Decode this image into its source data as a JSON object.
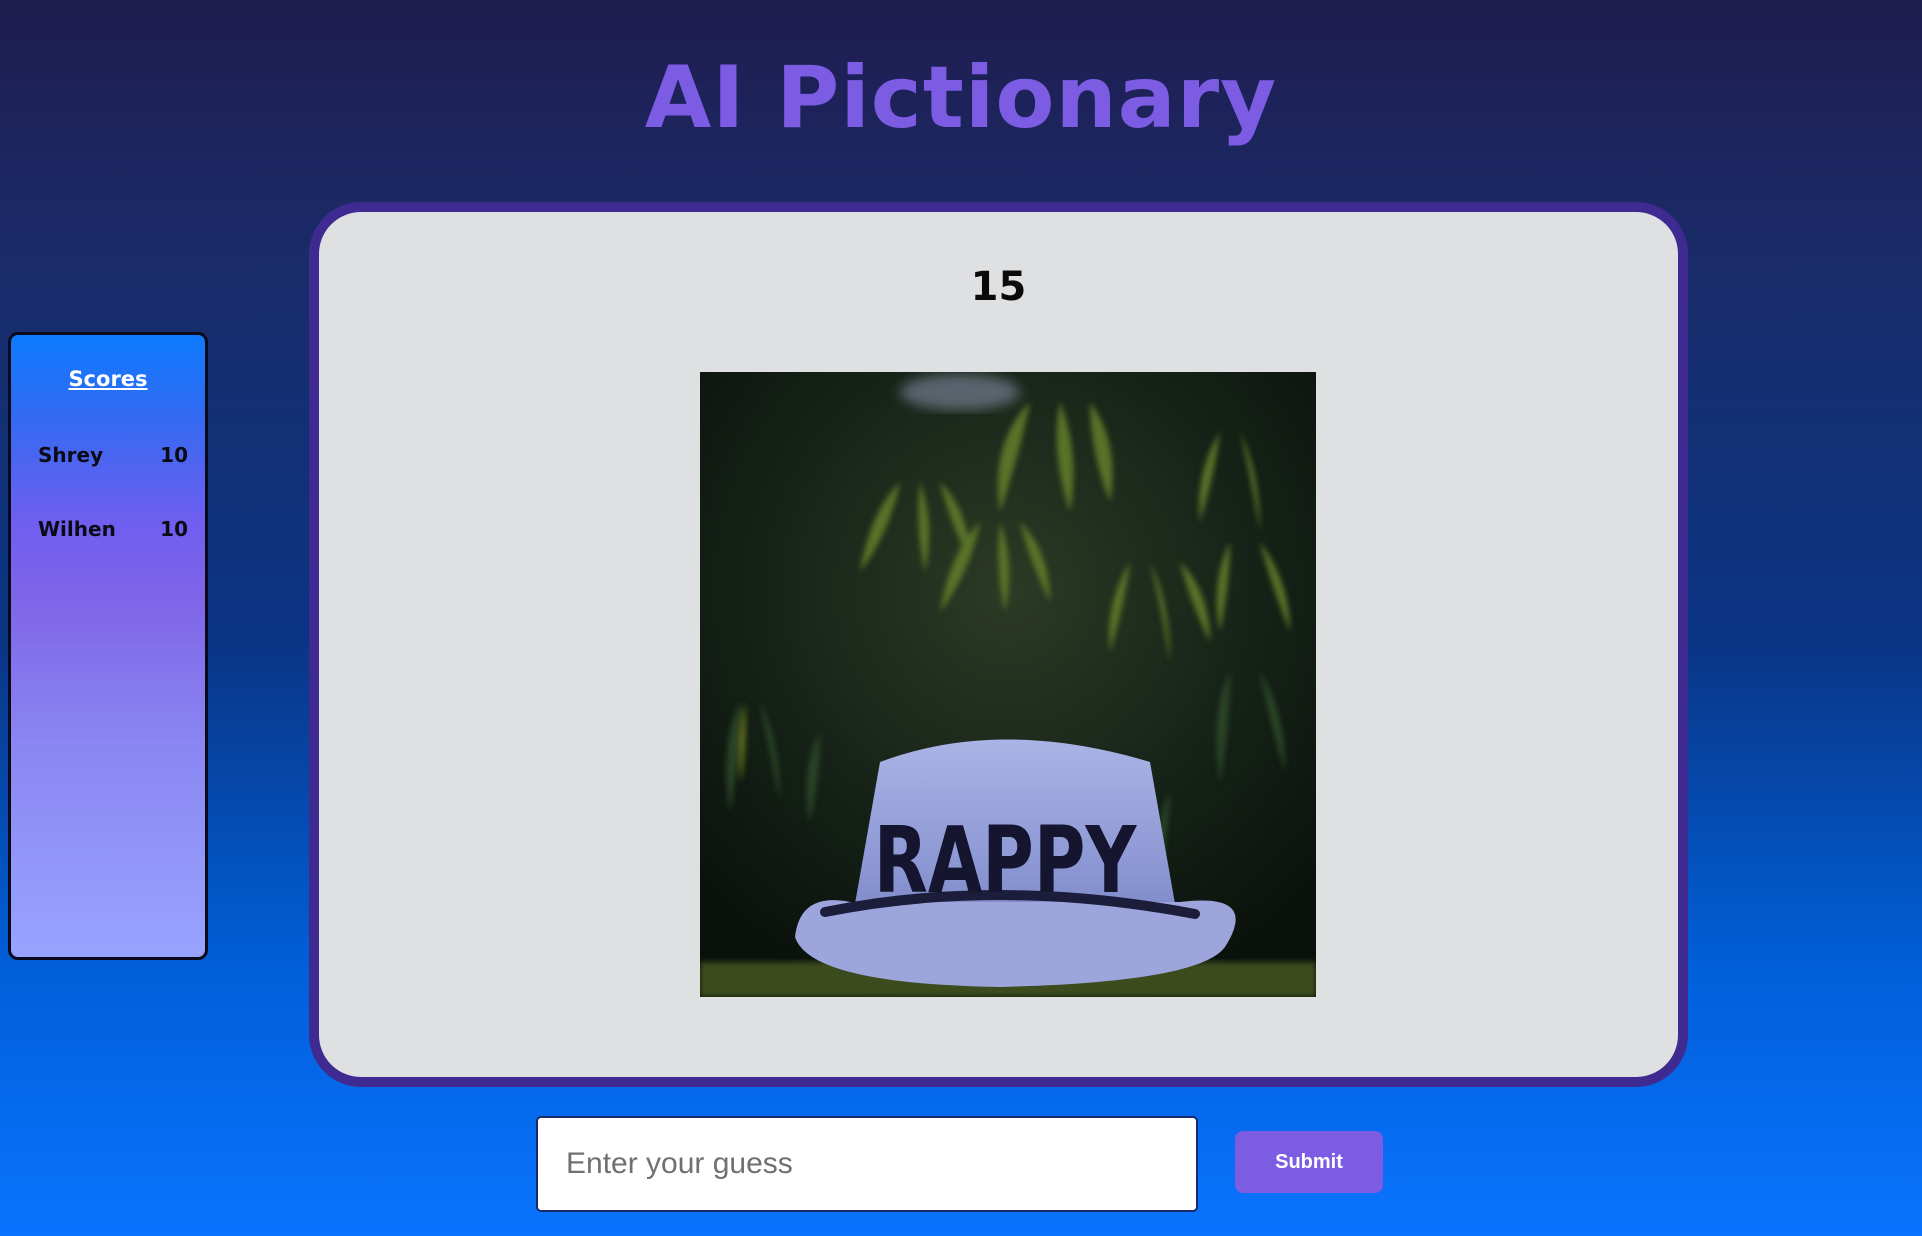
{
  "app": {
    "title": "AI Pictionary"
  },
  "scores": {
    "heading": "Scores",
    "players": [
      {
        "name": "Shrey",
        "score": "10"
      },
      {
        "name": "Wilhen",
        "score": "10"
      }
    ]
  },
  "game": {
    "timer": "15",
    "image_text": "RAPPY"
  },
  "guess": {
    "placeholder": "Enter your guess",
    "submit_label": "Submit"
  },
  "colors": {
    "accent": "#7d5ce4",
    "card_border": "#3f2a91",
    "card_background": "#dfe0e2"
  }
}
